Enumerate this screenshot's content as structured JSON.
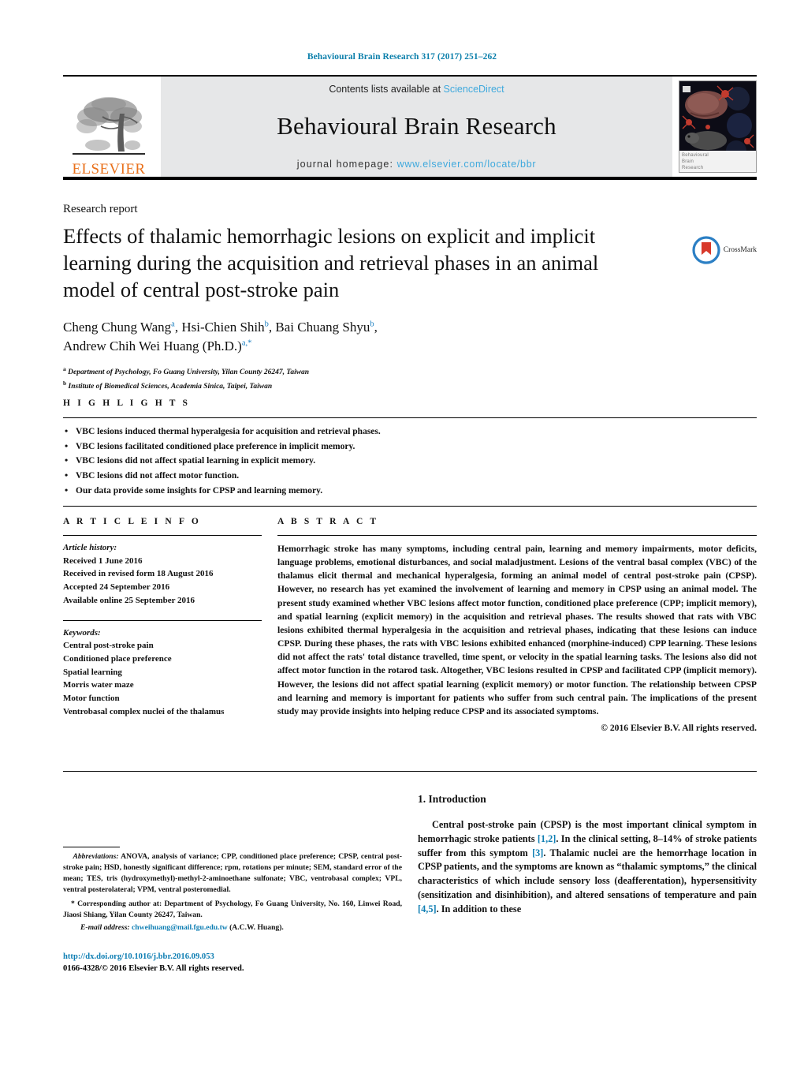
{
  "running_head": "Behavioural Brain Research 317 (2017) 251–262",
  "masthead": {
    "contents_prefix": "Contents lists available at ",
    "contents_link": "ScienceDirect",
    "journal_title": "Behavioural Brain Research",
    "homepage_prefix": "journal homepage: ",
    "homepage_link": "www.elsevier.com/locate/bbr",
    "publisher": "ELSEVIER",
    "cover_caption_line1": "Behavioural",
    "cover_caption_line2": "Brain",
    "cover_caption_line3": "Research"
  },
  "article": {
    "type_label": "Research report",
    "title": "Effects of thalamic hemorrhagic lesions on explicit and implicit learning during the acquisition and retrieval phases in an animal model of central post-stroke pain",
    "crossmark_label": "CrossMark",
    "authors": [
      {
        "name": "Cheng Chung Wang",
        "sup": "a",
        "sep": ", "
      },
      {
        "name": "Hsi-Chien Shih",
        "sup": "b",
        "sep": ", "
      },
      {
        "name": "Bai Chuang Shyu",
        "sup": "b",
        "sep": ","
      },
      {
        "name": "Andrew Chih Wei Huang (Ph.D.)",
        "sup": "a,*",
        "sep": ""
      }
    ],
    "affiliations": [
      {
        "marker": "a",
        "text": "Department of Psychology, Fo Guang University, Yilan County 26247, Taiwan"
      },
      {
        "marker": "b",
        "text": "Institute of Biomedical Sciences, Academia Sinica, Taipei, Taiwan"
      }
    ]
  },
  "highlights": {
    "heading": "H I G H L I G H T S",
    "items": [
      "VBC lesions induced thermal hyperalgesia for acquisition and retrieval phases.",
      "VBC lesions facilitated conditioned place preference in implicit memory.",
      "VBC lesions did not affect spatial learning in explicit memory.",
      "VBC lesions did not affect motor function.",
      "Our data provide some insights for CPSP and learning memory."
    ]
  },
  "article_info": {
    "heading": "A R T I C L E   I N F O",
    "history_title": "Article history:",
    "history": [
      "Received 1 June 2016",
      "Received in revised form 18 August 2016",
      "Accepted 24 September 2016",
      "Available online 25 September 2016"
    ],
    "keywords_title": "Keywords:",
    "keywords": [
      "Central post-stroke pain",
      "Conditioned place preference",
      "Spatial learning",
      "Morris water maze",
      "Motor function",
      "Ventrobasal complex nuclei of the thalamus"
    ]
  },
  "abstract": {
    "heading": "A B S T R A C T",
    "body": "Hemorrhagic stroke has many symptoms, including central pain, learning and memory impairments, motor deficits, language problems, emotional disturbances, and social maladjustment. Lesions of the ventral basal complex (VBC) of the thalamus elicit thermal and mechanical hyperalgesia, forming an animal model of central post-stroke pain (CPSP). However, no research has yet examined the involvement of learning and memory in CPSP using an animal model. The present study examined whether VBC lesions affect motor function, conditioned place preference (CPP; implicit memory), and spatial learning (explicit memory) in the acquisition and retrieval phases. The results showed that rats with VBC lesions exhibited thermal hyperalgesia in the acquisition and retrieval phases, indicating that these lesions can induce CPSP. During these phases, the rats with VBC lesions exhibited enhanced (morphine-induced) CPP learning. These lesions did not affect the rats' total distance travelled, time spent, or velocity in the spatial learning tasks. The lesions also did not affect motor function in the rotarod task. Altogether, VBC lesions resulted in CPSP and facilitated CPP (implicit memory). However, the lesions did not affect spatial learning (explicit memory) or motor function. The relationship between CPSP and learning and memory is important for patients who suffer from such central pain. The implications of the present study may provide insights into helping reduce CPSP and its associated symptoms.",
    "copyright": "© 2016 Elsevier B.V. All rights reserved."
  },
  "introduction": {
    "heading": "1.  Introduction",
    "paragraph_part1": "Central post-stroke pain (CPSP) is the most important clinical symptom in hemorrhagic stroke patients ",
    "ref1": "[1,2]",
    "paragraph_part2": ". In the clinical setting, 8–14% of stroke patients suffer from this symptom ",
    "ref2": "[3]",
    "paragraph_part3": ". Thalamic nuclei are the hemorrhage location in CPSP patients, and the symptoms are known as “thalamic symptoms,” the clinical characteristics of which include sensory loss (deafferentation), hypersensitivity (sensitization and disinhibition), and altered sensations of temperature and pain ",
    "ref3": "[4,5]",
    "paragraph_part4": ". In addition to these"
  },
  "footnotes": {
    "abbrev_label": "Abbreviations:",
    "abbrev_text": " ANOVA, analysis of variance; CPP, conditioned place preference; CPSP, central post-stroke pain; HSD, honestly significant difference; rpm, rotations per minute; SEM, standard error of the mean; TES, tris (hydroxymethyl)-methyl-2-aminoethane sulfonate; VBC, ventrobasal complex; VPL, ventral posterolateral; VPM, ventral posteromedial.",
    "corresponding": "*  Corresponding author at: Department of Psychology, Fo Guang University, No. 160, Linwei Road, Jiaosi Shiang, Yilan County 26247, Taiwan.",
    "email_label": "E-mail address:",
    "email_link": "chweihuang@mail.fgu.edu.tw",
    "email_suffix": " (A.C.W. Huang).",
    "doi": "http://dx.doi.org/10.1016/j.bbr.2016.09.053",
    "issn_line": "0166-4328/© 2016 Elsevier B.V. All rights reserved."
  },
  "colors": {
    "link_teal": "#0e7eb3",
    "sciencedirect_blue": "#3fa9dd",
    "elsevier_orange": "#E9711C",
    "masthead_gray": "#e6e7e8"
  }
}
